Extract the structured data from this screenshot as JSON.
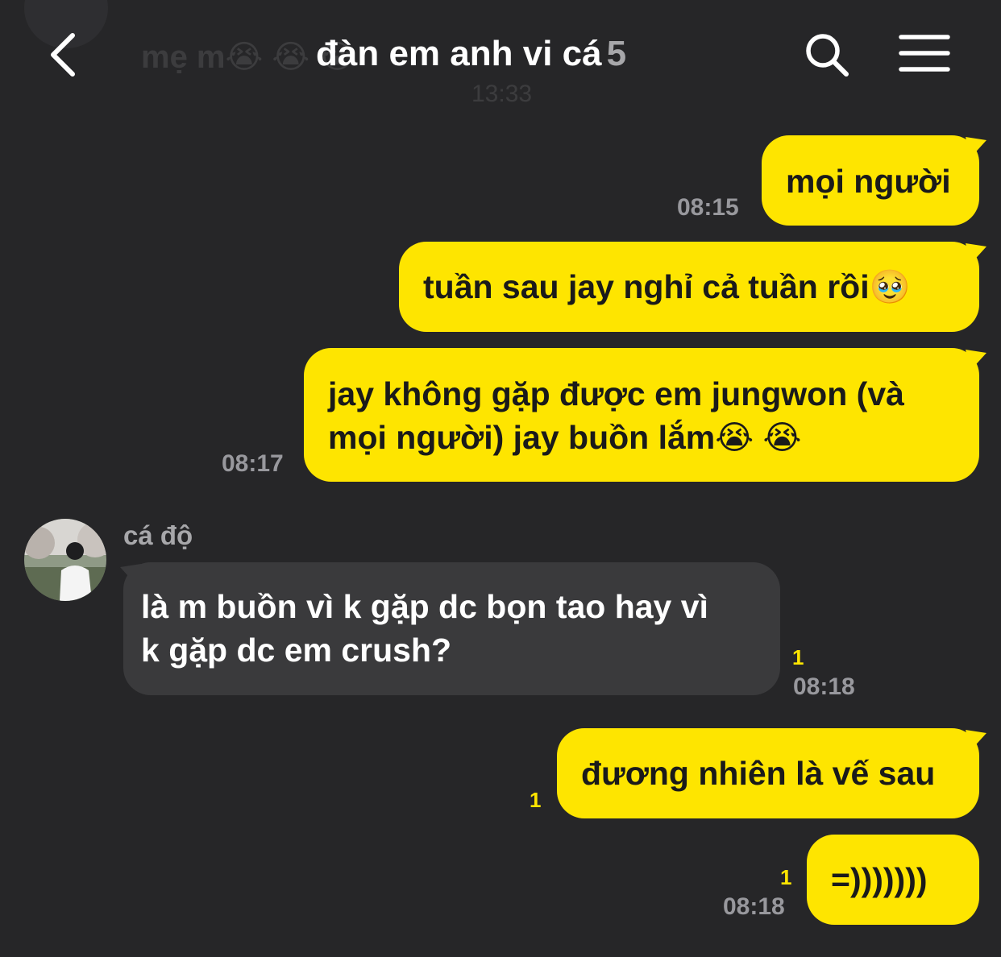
{
  "background_color": "#262628",
  "accent_color": "#fee500",
  "ghost": {
    "text": "mẹ m😭 😭 😭",
    "time": "13:33"
  },
  "header": {
    "title": "đàn em anh vi cá",
    "member_count": "5",
    "back_icon": "chevron-left-icon",
    "search_icon": "search-icon",
    "menu_icon": "hamburger-menu-icon"
  },
  "messages": [
    {
      "id": "m1",
      "from": "me",
      "text": "mọi người",
      "time": "08:15"
    },
    {
      "id": "m2",
      "from": "me",
      "text": "tuần sau jay nghỉ cả tuần rồi🥹"
    },
    {
      "id": "m3",
      "from": "me",
      "lines": [
        "jay không gặp được em jungwon (và",
        "mọi người) jay buồn lắm😭 😭"
      ],
      "time": "08:17"
    },
    {
      "id": "m4",
      "from": "other",
      "sender": "cá độ",
      "lines": [
        "là m buồn vì k gặp dc bọn tao hay vì",
        "k gặp dc em crush?"
      ],
      "unread": "1",
      "time": "08:18"
    },
    {
      "id": "m5",
      "from": "me",
      "text": "đương nhiên là vế sau",
      "unread": "1"
    },
    {
      "id": "m6",
      "from": "me",
      "text": "=)))))))",
      "unread": "1",
      "time": "08:18"
    }
  ]
}
